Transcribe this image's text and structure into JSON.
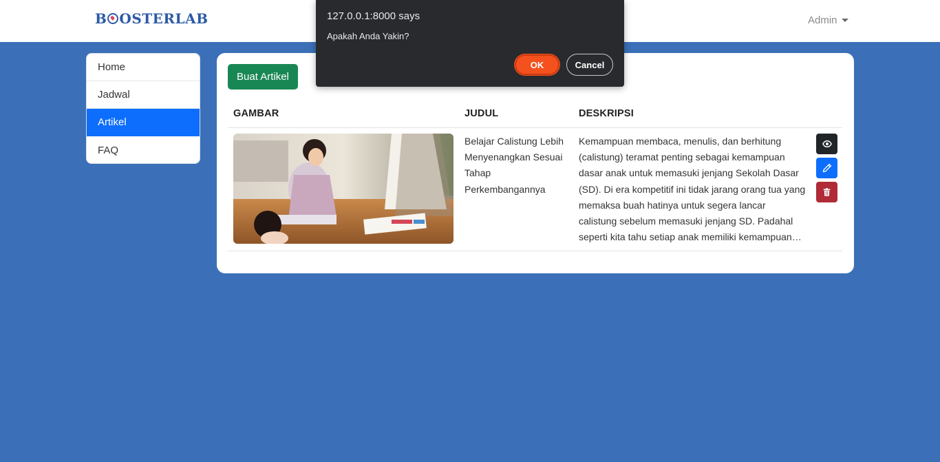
{
  "navbar": {
    "brand_left": "B",
    "brand_right": "OSTERLAB",
    "user_menu": "Admin"
  },
  "sidebar": {
    "items": [
      {
        "label": "Home"
      },
      {
        "label": "Jadwal"
      },
      {
        "label": "Artikel",
        "active": true
      },
      {
        "label": "FAQ"
      }
    ]
  },
  "main": {
    "create_button": "Buat Artikel",
    "table": {
      "headers": [
        "GAMBAR",
        "JUDUL",
        "DESKRIPSI"
      ],
      "rows": [
        {
          "image": "children-drawing-photo",
          "title": "Belajar Calistung Lebih Menyenangkan Sesuai Tahap Perkembangannya",
          "description": "Kemampuan membaca, menulis, dan berhitung (calistung) teramat penting sebagai kemampuan dasar anak untuk memasuki jenjang Sekolah Dasar (SD). Di era kompetitif ini tidak jarang orang tua yang memaksa buah hatinya untuk segera lancar calistung sebelum memasuki jenjang SD. Padahal seperti kita tahu setiap anak memiliki kemampuan yang berbeda-beda."
        }
      ],
      "actions": [
        "eye-icon",
        "pencil-icon",
        "trash-icon"
      ]
    }
  },
  "dialog": {
    "origin": "127.0.0.1:8000 says",
    "message": "Apakah Anda Yakin?",
    "ok_label": "OK",
    "cancel_label": "Cancel"
  },
  "colors": {
    "background": "#3b70b8",
    "brand": "#2c5aa6",
    "active": "#0d6efd",
    "success": "#198754",
    "danger": "#b02a37",
    "dark": "#212529",
    "dialog_ok": "#f4511e"
  }
}
